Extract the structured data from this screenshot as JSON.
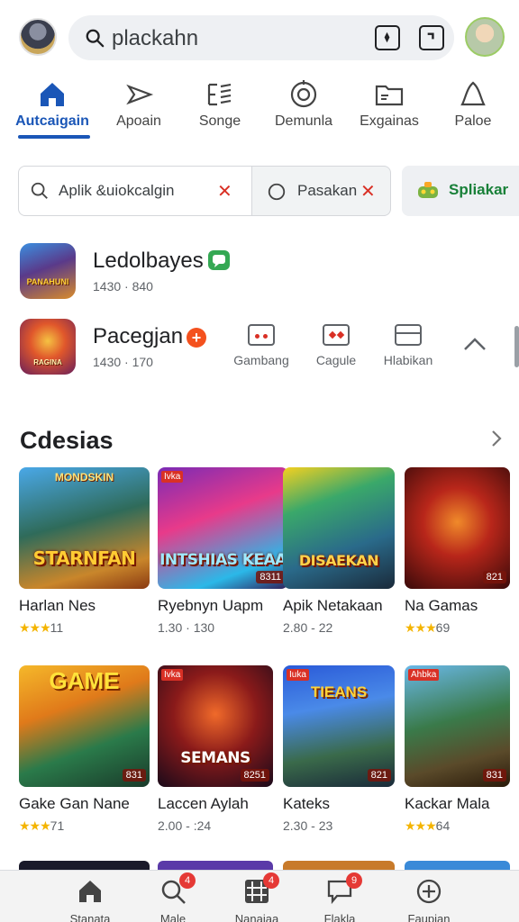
{
  "search": {
    "query": "plackahn"
  },
  "categories": [
    {
      "label": "Autcaigain",
      "active": true
    },
    {
      "label": "Apoain"
    },
    {
      "label": "Songe"
    },
    {
      "label": "Demunla"
    },
    {
      "label": "Exgainas"
    },
    {
      "label": "Paloe"
    }
  ],
  "filters": {
    "chip1": "Aplik &uiokcalgin",
    "chip2": "Pasakan",
    "chip3": "Spliakar"
  },
  "apps": [
    {
      "name": "Ledolbayes",
      "meta": "1430 · 840",
      "icon_text": "PANAHUNI"
    },
    {
      "name": "Pacegjan",
      "meta": "1430 · 170",
      "icon_text": "RAGINA"
    }
  ],
  "app_actions": [
    {
      "label": "Gambang"
    },
    {
      "label": "Cagule"
    },
    {
      "label": "Hlabikan"
    }
  ],
  "section": {
    "title": "Cdesias"
  },
  "cards": [
    {
      "name": "Harlan Nes",
      "stars": "★★★",
      "meta": "11",
      "art_top": "MONDSKIN",
      "art": "STARNFAN",
      "tag": "",
      "price": ""
    },
    {
      "name": "Ryebnyn Uapm",
      "stars": "",
      "meta": "1.30 · 130",
      "art_top": "",
      "art": "INTSHIAS KEAA",
      "tag": "Ivka",
      "price": "8311"
    },
    {
      "name": "Apik Netakaan",
      "stars": "",
      "meta": "2.80 - 22",
      "art_top": "",
      "art": "DISAEKAN",
      "tag": "",
      "price": ""
    },
    {
      "name": "Na Gamas",
      "stars": "★★★",
      "meta": "69",
      "art_top": "",
      "art": "",
      "tag": "",
      "price": "821"
    },
    {
      "name": "Gake Gan Nane",
      "stars": "★★★",
      "meta": "71",
      "art_top": "GAME",
      "art": "",
      "tag": "",
      "price": "831"
    },
    {
      "name": "Laccen Aylah",
      "stars": "",
      "meta": "2.00 - :24",
      "art_top": "",
      "art": "SEMANS",
      "tag": "Ivka",
      "price": "8251"
    },
    {
      "name": "Kateks",
      "stars": "",
      "meta": "2.30 - 23",
      "art_top": "TIEANS",
      "art": "",
      "tag": "Iuka",
      "price": "821"
    },
    {
      "name": "Kackar Mala",
      "stars": "★★★",
      "meta": "64",
      "art_top": "",
      "art": "",
      "tag": "Ahbka",
      "price": "831"
    }
  ],
  "bottom_nav": [
    {
      "label": "Stanata",
      "badge": ""
    },
    {
      "label": "Male",
      "badge": "4"
    },
    {
      "label": "Nanajaa",
      "badge": "4"
    },
    {
      "label": "Flakla",
      "badge": "9"
    },
    {
      "label": "Faupian",
      "badge": ""
    }
  ],
  "colors": {
    "accent": "#1a56b7",
    "star": "#f4b400",
    "close": "#d93025",
    "positive": "#34a853"
  }
}
